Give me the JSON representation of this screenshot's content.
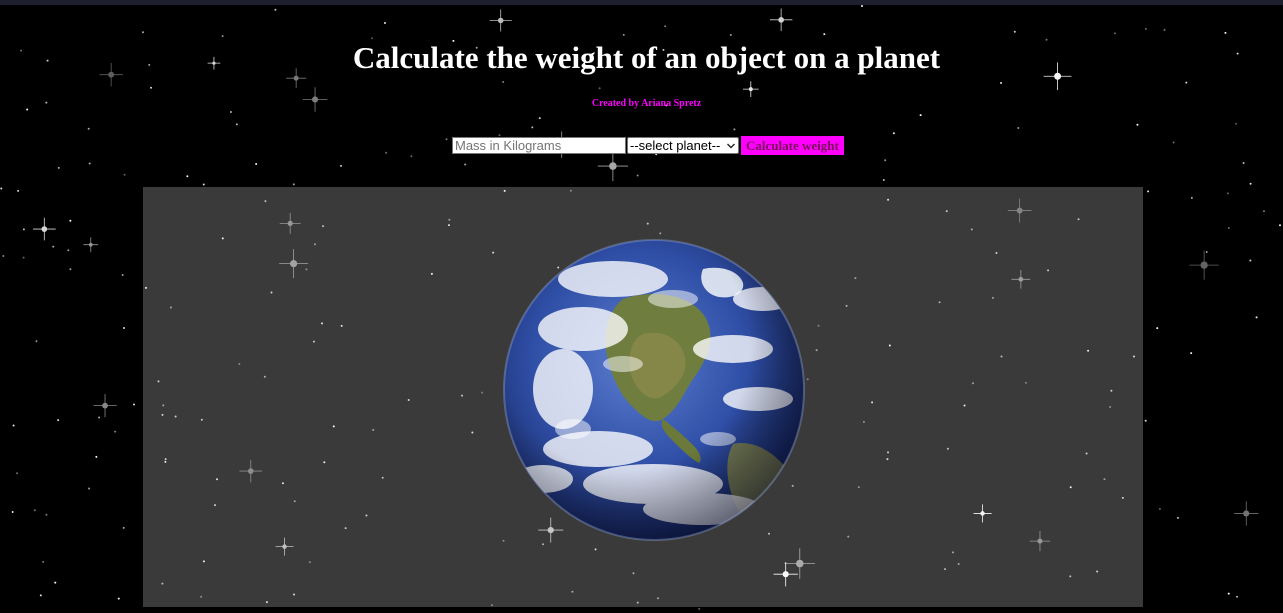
{
  "page": {
    "title": "Calculate the weight of an object on a planet",
    "credit": "Created by Ariana Spretz"
  },
  "form": {
    "mass_placeholder": "Mass in Kilograms",
    "mass_value": "",
    "planet_selected": "--select planet--",
    "calculate_label": "Calculate weight"
  },
  "image": {
    "subject": "earth"
  },
  "colors": {
    "background": "#000000",
    "accent": "#ff00ff",
    "title": "#ffffff",
    "panel": "#3a3a3a",
    "ocean": "#2b4a9e",
    "land": "#6b7a3a"
  }
}
